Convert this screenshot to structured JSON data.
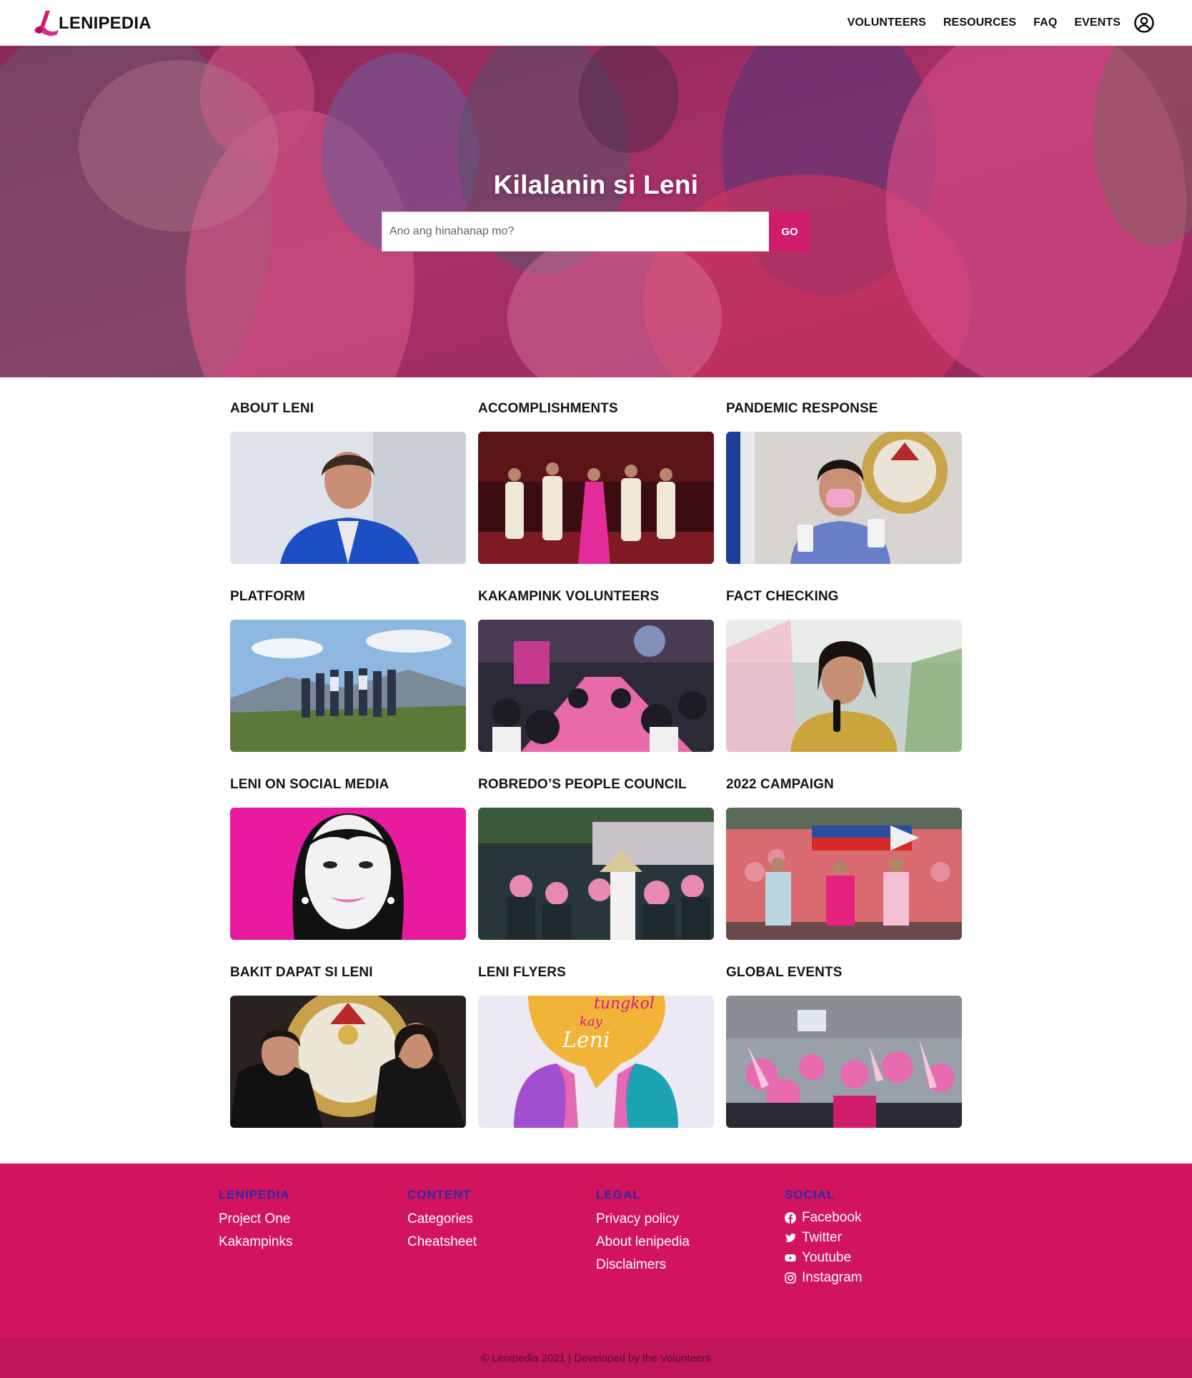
{
  "brand": {
    "name": "LENIPEDIA",
    "accent": "#d01c6a",
    "footer_bg": "#d2145e",
    "footer_heading_color": "#2a2aa8"
  },
  "nav": {
    "links": [
      "VOLUNTEERS",
      "RESOURCES",
      "FAQ",
      "EVENTS"
    ],
    "account_icon": "user-circle-icon"
  },
  "hero": {
    "title": "Kilalanin si Leni",
    "search": {
      "placeholder": "Ano ang hinahanap mo?",
      "value": "",
      "button_label": "GO"
    }
  },
  "categories": [
    {
      "title": "ABOUT LENI"
    },
    {
      "title": "ACCOMPLISHMENTS"
    },
    {
      "title": "PANDEMIC RESPONSE"
    },
    {
      "title": "PLATFORM"
    },
    {
      "title": "KAKAMPINK VOLUNTEERS"
    },
    {
      "title": "FACT CHECKING"
    },
    {
      "title": "LENI ON SOCIAL MEDIA"
    },
    {
      "title": "ROBREDO’S PEOPLE COUNCIL"
    },
    {
      "title": "2022 CAMPAIGN"
    },
    {
      "title": "BAKIT DAPAT SI LENI"
    },
    {
      "title": "LENI FLYERS"
    },
    {
      "title": "GLOBAL EVENTS"
    }
  ],
  "flyer_art_text": [
    "tungkol",
    "kay",
    "Leni"
  ],
  "footer": {
    "columns": [
      {
        "heading": "LENIPEDIA",
        "links": [
          "Project One",
          "Kakampinks"
        ]
      },
      {
        "heading": "CONTENT",
        "links": [
          "Categories",
          "Cheatsheet"
        ]
      },
      {
        "heading": "LEGAL",
        "links": [
          "Privacy policy",
          "About lenipedia",
          "Disclaimers"
        ]
      }
    ],
    "social": {
      "heading": "SOCIAL",
      "links": [
        {
          "label": "Facebook",
          "icon": "facebook-icon"
        },
        {
          "label": "Twitter",
          "icon": "twitter-icon"
        },
        {
          "label": "Youtube",
          "icon": "youtube-icon"
        },
        {
          "label": "Instagram",
          "icon": "instagram-icon"
        }
      ]
    },
    "copyright": "© Lenipedia 2021 | Developed by the Volunteers"
  }
}
